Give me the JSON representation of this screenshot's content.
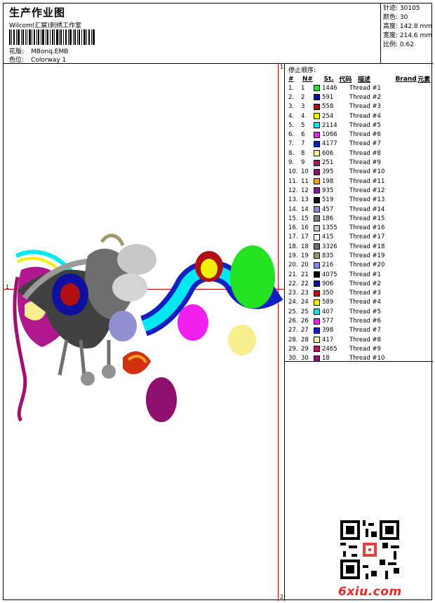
{
  "header": {
    "title": "生产作业图",
    "subtitle": "Wilcom(汇宸)刺绣工作室",
    "pattern_label": "花版:",
    "pattern_value": "MBonq.EMB",
    "color_label": "色位:",
    "color_value": "Colorway 1"
  },
  "stats": {
    "stitches": "针迹: 30105",
    "colors": "颜色: 30",
    "height": "高度: 142.8 mm",
    "width": "宽度: 214.6 mm",
    "scale": "比例: 0.62"
  },
  "markers": {
    "top_left": "1",
    "top_right": "1",
    "bottom_right": "2"
  },
  "table": {
    "title": "停止顺序:",
    "headers": {
      "idx": "#",
      "no": "N#",
      "st": "St.",
      "code": "代码",
      "desc": "描述",
      "brand": "Brand",
      "elem": "元素"
    },
    "rows": [
      {
        "idx": "1.",
        "no": "1",
        "color": "#22e222",
        "st": "1446",
        "desc": "Thread #1"
      },
      {
        "idx": "2.",
        "no": "2",
        "color": "#1010a0",
        "st": "591",
        "desc": "Thread #2"
      },
      {
        "idx": "3.",
        "no": "3",
        "color": "#b01010",
        "st": "558",
        "desc": "Thread #3"
      },
      {
        "idx": "4.",
        "no": "4",
        "color": "#f0f000",
        "st": "254",
        "desc": "Thread #4"
      },
      {
        "idx": "5.",
        "no": "5",
        "color": "#00e8f0",
        "st": "2114",
        "desc": "Thread #5"
      },
      {
        "idx": "6.",
        "no": "6",
        "color": "#f020f0",
        "st": "1066",
        "desc": "Thread #6"
      },
      {
        "idx": "7.",
        "no": "7",
        "color": "#1020c0",
        "st": "4177",
        "desc": "Thread #7"
      },
      {
        "idx": "8.",
        "no": "8",
        "color": "#f8f090",
        "st": "606",
        "desc": "Thread #8"
      },
      {
        "idx": "9.",
        "no": "9",
        "color": "#b01860",
        "st": "251",
        "desc": "Thread #9"
      },
      {
        "idx": "10.",
        "no": "10",
        "color": "#901070",
        "st": "395",
        "desc": "Thread #10"
      },
      {
        "idx": "11.",
        "no": "11",
        "color": "#f0a020",
        "st": "198",
        "desc": "Thread #11"
      },
      {
        "idx": "12.",
        "no": "12",
        "color": "#8a1890",
        "st": "935",
        "desc": "Thread #12"
      },
      {
        "idx": "13.",
        "no": "13",
        "color": "#101010",
        "st": "519",
        "desc": "Thread #13"
      },
      {
        "idx": "14.",
        "no": "14",
        "color": "#9090d0",
        "st": "457",
        "desc": "Thread #14"
      },
      {
        "idx": "15.",
        "no": "15",
        "color": "#808080",
        "st": "186",
        "desc": "Thread #15"
      },
      {
        "idx": "16.",
        "no": "16",
        "color": "#c8c8c8",
        "st": "1355",
        "desc": "Thread #16"
      },
      {
        "idx": "17.",
        "no": "17",
        "color": "#ffffff",
        "st": "415",
        "desc": "Thread #17"
      },
      {
        "idx": "18.",
        "no": "18",
        "color": "#707070",
        "st": "3326",
        "desc": "Thread #18"
      },
      {
        "idx": "19.",
        "no": "19",
        "color": "#a09868",
        "st": "835",
        "desc": "Thread #19"
      },
      {
        "idx": "20.",
        "no": "20",
        "color": "#8888f0",
        "st": "216",
        "desc": "Thread #20"
      },
      {
        "idx": "21.",
        "no": "21",
        "color": "#000000",
        "st": "4075",
        "desc": "Thread #1"
      },
      {
        "idx": "22.",
        "no": "22",
        "color": "#1010a0",
        "st": "906",
        "desc": "Thread #2"
      },
      {
        "idx": "23.",
        "no": "23",
        "color": "#b01010",
        "st": "350",
        "desc": "Thread #3"
      },
      {
        "idx": "24.",
        "no": "24",
        "color": "#f0f000",
        "st": "589",
        "desc": "Thread #4"
      },
      {
        "idx": "25.",
        "no": "25",
        "color": "#00e8f0",
        "st": "407",
        "desc": "Thread #5"
      },
      {
        "idx": "26.",
        "no": "26",
        "color": "#f020f0",
        "st": "577",
        "desc": "Thread #6"
      },
      {
        "idx": "27.",
        "no": "27",
        "color": "#1020c0",
        "st": "398",
        "desc": "Thread #7"
      },
      {
        "idx": "28.",
        "no": "28",
        "color": "#f8f090",
        "st": "417",
        "desc": "Thread #8"
      },
      {
        "idx": "29.",
        "no": "29",
        "color": "#b01860",
        "st": "2465",
        "desc": "Thread #9"
      },
      {
        "idx": "30.",
        "no": "30",
        "color": "#901070",
        "st": "18",
        "desc": "Thread #10"
      }
    ]
  },
  "watermark": {
    "text": "6xiu.com"
  }
}
